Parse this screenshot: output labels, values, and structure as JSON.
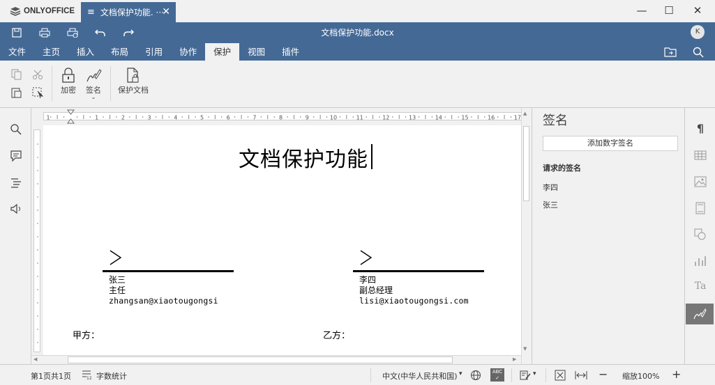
{
  "titlebar": {
    "brand": "ONLYOFFICE",
    "tab_label": "文档保护功能. ···",
    "tab_close": "✕",
    "minimize": "—",
    "maximize": "☐",
    "close": "✕"
  },
  "header": {
    "doc_title": "文档保护功能.docx",
    "avatar_letter": "K"
  },
  "menu": {
    "tabs": [
      {
        "label": "文件"
      },
      {
        "label": "主页"
      },
      {
        "label": "插入"
      },
      {
        "label": "布局"
      },
      {
        "label": "引用"
      },
      {
        "label": "协作"
      },
      {
        "label": "保护",
        "active": true
      },
      {
        "label": "视图"
      },
      {
        "label": "插件"
      }
    ]
  },
  "ribbon": {
    "encrypt_label": "加密",
    "signature_label": "签名",
    "protect_doc_label": "保护文档"
  },
  "ruler_numbers": [
    "1",
    "1",
    "2",
    "3",
    "4",
    "5",
    "6",
    "7",
    "8",
    "9",
    "10",
    "11",
    "12",
    "13",
    "14",
    "15",
    "16",
    "17"
  ],
  "document": {
    "title": "文档保护功能",
    "signature_left": {
      "name": "张三",
      "title": "主任",
      "email": "zhangsan@xiaotougongsi"
    },
    "signature_right": {
      "name": "李四",
      "title": "副总经理",
      "email": "lisi@xiaotougongsi.com"
    },
    "party_a": "甲方：",
    "party_b": "乙方："
  },
  "panel": {
    "heading": "签名",
    "add_button": "添加数字签名",
    "requested_heading": "请求的签名",
    "requested": [
      "李四",
      "张三"
    ]
  },
  "status": {
    "page_info": "第1页共1页",
    "word_count": "字数统计",
    "language": "中文(中华人民共和国)",
    "zoom": "缩放100%"
  },
  "colors": {
    "accent": "#446995",
    "active_tool": "#777777"
  }
}
